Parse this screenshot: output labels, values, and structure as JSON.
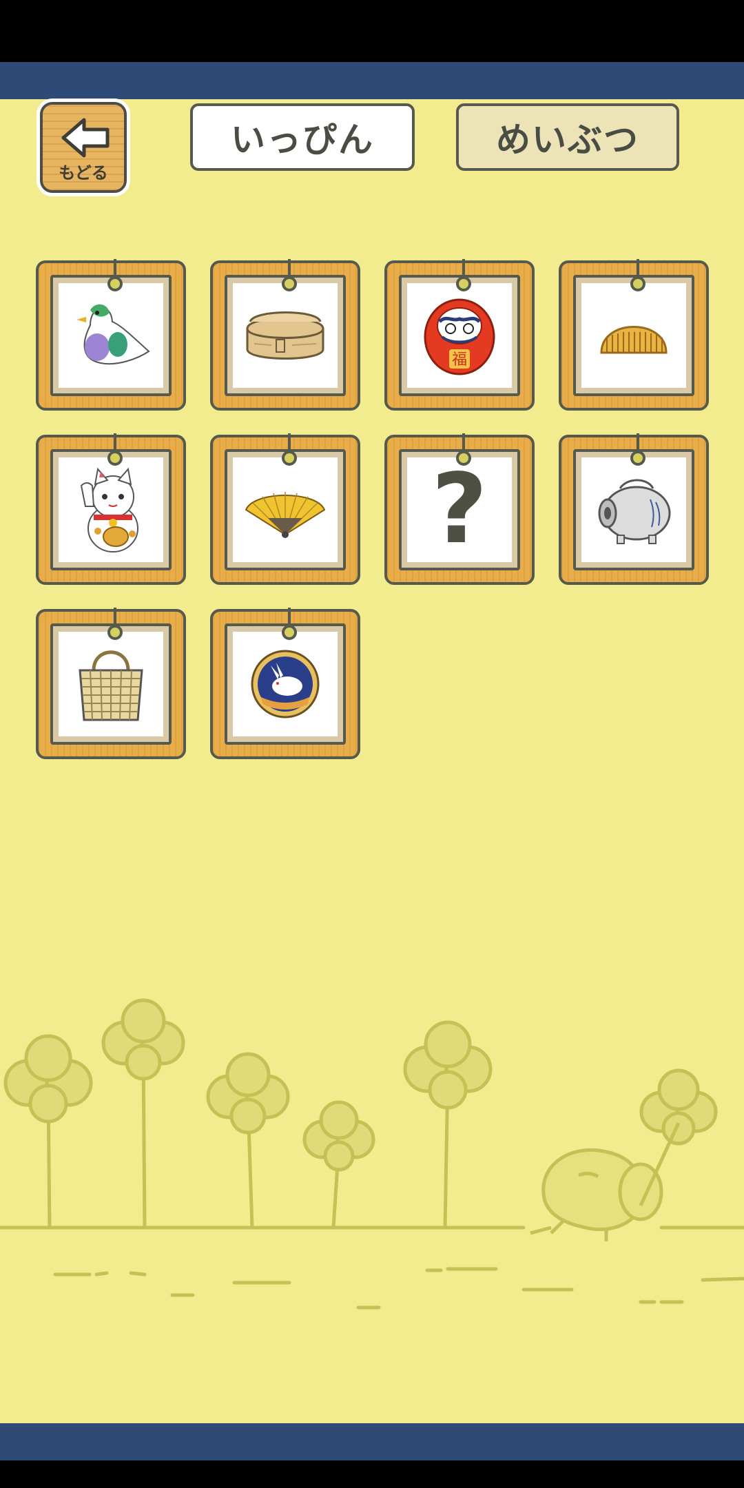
{
  "back_button": {
    "label": "もどる",
    "icon": "left-arrow-icon"
  },
  "tabs": [
    {
      "label": "いっぴん",
      "selected": true
    },
    {
      "label": "めいぶつ",
      "selected": false
    }
  ],
  "items": [
    {
      "name": "pigeon-whistle",
      "locked": false
    },
    {
      "name": "bento-box",
      "locked": false
    },
    {
      "name": "daruma",
      "locked": false
    },
    {
      "name": "comb",
      "locked": false
    },
    {
      "name": "maneki-neko",
      "locked": false
    },
    {
      "name": "folding-fan",
      "locked": false
    },
    {
      "name": "unknown-item",
      "locked": true,
      "label": "?"
    },
    {
      "name": "mosquito-coil-pig",
      "locked": false
    },
    {
      "name": "woven-basket",
      "locked": false
    },
    {
      "name": "rabbit-plate",
      "locked": false
    }
  ],
  "colors": {
    "background": "#f2ec8f",
    "band": "#2f4a77",
    "frame_wood": "#e8ac48",
    "outline": "#555a4c"
  }
}
